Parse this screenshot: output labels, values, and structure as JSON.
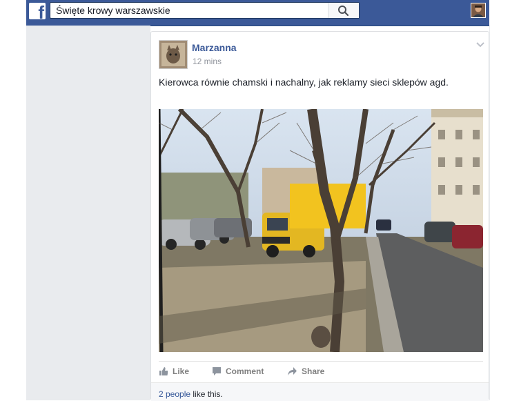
{
  "header": {
    "search": {
      "value": "Święte krowy warszawskie"
    },
    "icons": {
      "logo": "facebook-logo-icon",
      "search": "search-icon",
      "profile": "profile-avatar-icon"
    }
  },
  "post": {
    "author": "Marzanna",
    "time": "12 mins",
    "text": "Kierowca równie chamski i nachalny, jak reklamy sieci sklepów agd.",
    "actions": {
      "like": "Like",
      "comment": "Comment",
      "share": "Share"
    },
    "likes": {
      "count_link": "2 people",
      "suffix": " like this."
    }
  },
  "colors": {
    "brand": "#3b5998",
    "link": "#365899",
    "background": "#e9ebee"
  }
}
